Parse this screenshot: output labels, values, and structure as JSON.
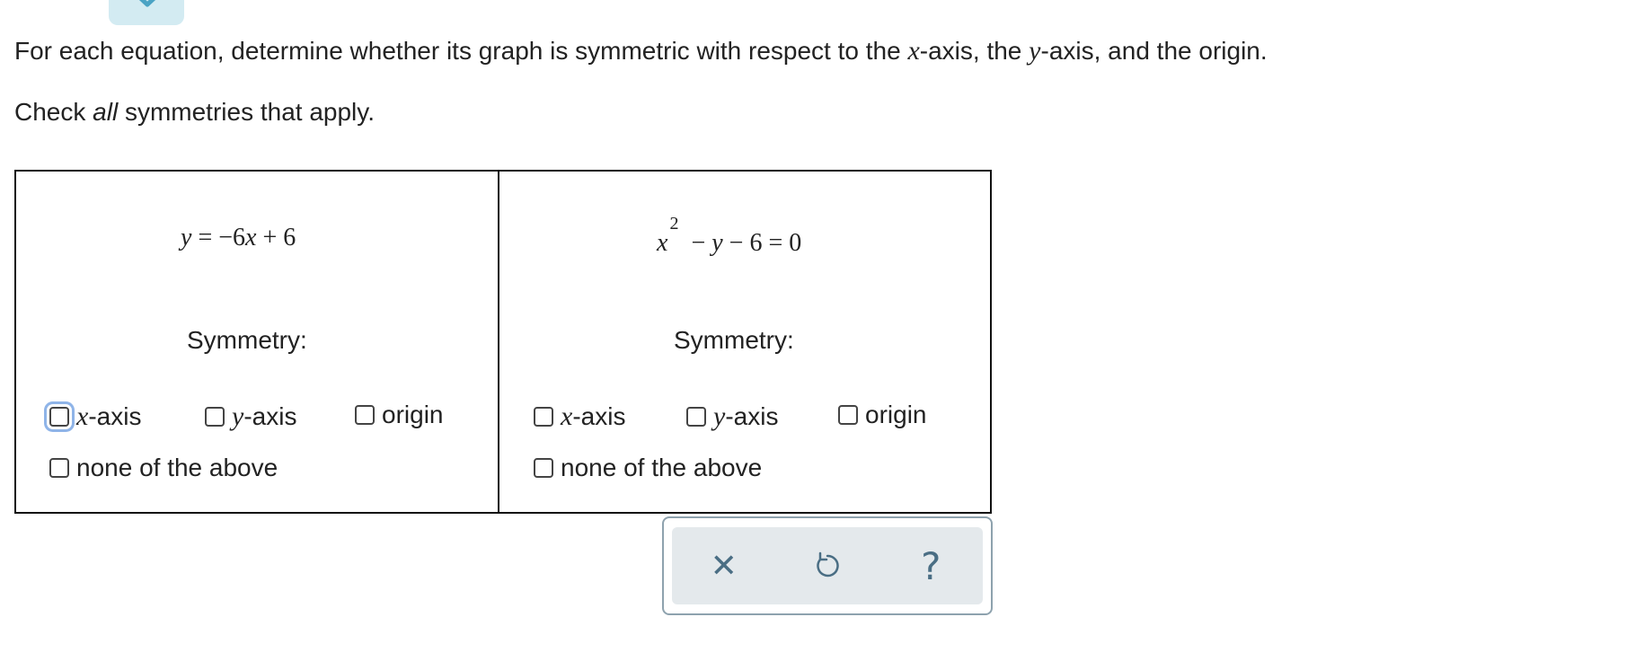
{
  "instruction": {
    "part1": "For each equation, determine whether its graph is symmetric with respect to the ",
    "var_x": "x",
    "part2": "-axis, the ",
    "var_y": "y",
    "part3": "-axis, and the origin."
  },
  "note": {
    "prefix": "Check ",
    "emph": "all",
    "suffix": " symmetries that apply."
  },
  "problems": [
    {
      "equation": {
        "y": "y",
        "rest": "= −6",
        "x": "x",
        "tail": "+ 6"
      },
      "symmetry_label": "Symmetry:",
      "options": {
        "x_var": "x",
        "x_suffix": "-axis",
        "y_var": "y",
        "y_suffix": "-axis",
        "origin": "origin",
        "none": "none of the above"
      }
    },
    {
      "equation": {
        "x": "x",
        "exp": "2",
        "rest": "− ",
        "y": "y",
        "tail": "− 6 = 0"
      },
      "symmetry_label": "Symmetry:",
      "options": {
        "x_var": "x",
        "x_suffix": "-axis",
        "y_var": "y",
        "y_suffix": "-axis",
        "origin": "origin",
        "none": "none of the above"
      }
    }
  ],
  "toolbar": {
    "clear_icon": "✕",
    "undo_icon": "undo-arrow",
    "help_icon": "?"
  },
  "colors": {
    "accent_tab": "#d3ebf2",
    "toolbar_icon": "#4a6e84",
    "focus_ring": "#8fb4e8"
  }
}
